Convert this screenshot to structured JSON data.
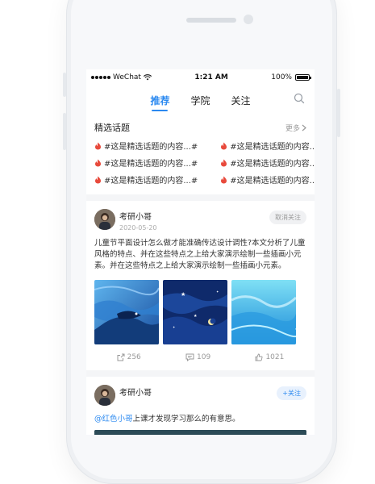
{
  "status_bar": {
    "carrier": "WeChat",
    "time": "1:21 AM",
    "battery": "100%"
  },
  "nav": {
    "tabs": [
      "推荐",
      "学院",
      "关注"
    ],
    "active_tab": 0
  },
  "topics": {
    "title": "精选话题",
    "more_label": "更多",
    "items": [
      "#这是精选话题的内容...#",
      "#这是精选话题的内容...#",
      "#这是精选话题的内容...#",
      "#这是精选话题的内容...#",
      "#这是精选话题的内容...#",
      "#这是精选话题的内容...#"
    ]
  },
  "posts": [
    {
      "author": "考研小哥",
      "date": "2020-05-20",
      "follow_label": "取消关注",
      "text": "儿童节平面设计怎么做才能准确传达设计调性?本文分析了儿童风格的特点、并在这些特点之上给大家演示绘制一些插画小元素。并在这些特点之上给大家演示绘制一些插画小元素。",
      "shares": "256",
      "comments": "109",
      "likes": "1021"
    },
    {
      "author": "考研小哥",
      "follow_label": "+关注",
      "mention": "@红色小哥",
      "text": "上课才发现学习那么的有意思。"
    }
  ],
  "colors": {
    "accent": "#2b89f0",
    "fire": "#e84a3c"
  }
}
